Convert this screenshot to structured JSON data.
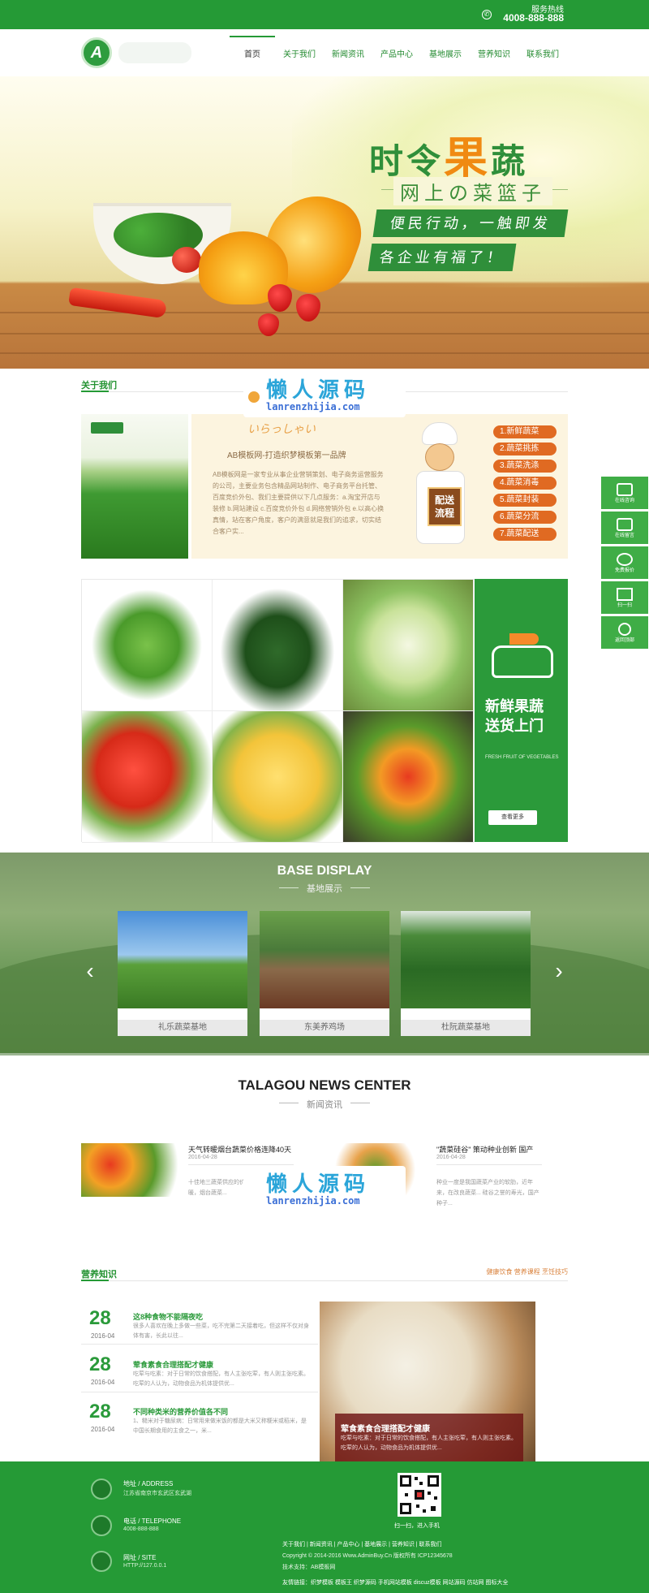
{
  "header": {
    "hotline_label": "服务热线",
    "hotline_number": "4008-888-888",
    "logo_letter": "A",
    "nav": [
      "首页",
      "关于我们",
      "新闻资讯",
      "产品中心",
      "基地展示",
      "营养知识",
      "联系我们"
    ],
    "active_nav": 0
  },
  "banner": {
    "title_a": "时令",
    "title_b": "果",
    "title_c": "蔬",
    "subtitle": "网上の菜篮子",
    "tag1": "便民行动，一触即发",
    "tag2": "各企业有福了！"
  },
  "about": {
    "section_title": "关于我们",
    "script_text": "いらっしゃい",
    "heading": "AB模板网-打造织梦模板第一品牌",
    "text": "AB模板网是一家专业从事企业营销策划、电子商务运营服务的公司，主要业务包含精品网站制作、电子商务平台托管、百度竞价外包、我们主要提供以下几点服务：a.淘宝开店与装修 b.网站建设 c.百度竞价外包 d.网络营销外包 e.以高心换真情，站在客户角度，客户的满意就是我们的追求，切实结合客户实...",
    "chef_board": "配送\n流程",
    "steps": [
      "1.新鲜蔬菜",
      "2.蔬菜挑拣",
      "3.蔬菜洗涤",
      "4.蔬菜消毒",
      "5.蔬菜封装",
      "6.蔬菜分流",
      "7.蔬菜配送"
    ]
  },
  "products": {
    "promo_title": "新鲜果蔬\n送货上门",
    "promo_sub": "FRESH FRUIT OF VEGETABLES",
    "promo_button": "查看更多"
  },
  "base": {
    "title": "BASE DISPLAY",
    "subtitle": "基地展示",
    "items": [
      "礼乐蔬菜基地",
      "东美养鸡场",
      "杜阮蔬菜基地"
    ],
    "prev_arrow": "‹",
    "next_arrow": "›"
  },
  "news": {
    "title": "TALAGOU NEWS CENTER",
    "subtitle": "新闻资讯",
    "items": [
      {
        "title": "天气转暖烟台蔬菜价格连降40天",
        "date": "2016-04-28",
        "text": "十佳地三蔬菜供应的价格... 近期天气转暖，烟台蔬菜..."
      },
      {
        "title": "\"蔬菜硅谷\" 策动种业创新 国产",
        "date": "2016-04-28",
        "text": "种业一度是我国蔬菜产业的软肋，近年来，在改良蔬菜... 硅谷之誉的寿光，国产种子..."
      }
    ]
  },
  "watermark": {
    "text": "懒人源码",
    "url": "lanrenzhijia.com"
  },
  "nutrition": {
    "section_title": "营养知识",
    "links": "健康饮食  营养课程  烹饪技巧",
    "items": [
      {
        "day": "28",
        "ym": "2016-04",
        "title": "这8种食物不能隔夜吃",
        "text": "很多人喜欢在晚上多做一些菜，吃不完第二天接着吃，但这样不仅对身体有害，长此以往..."
      },
      {
        "day": "28",
        "ym": "2016-04",
        "title": "荤食素食合理搭配才健康",
        "text": "吃荤与吃素：对于日常的饮食搭配，有人主张吃荤，有人则主张吃素。吃荤的人认为，动物食品为机体提供优..."
      },
      {
        "day": "28",
        "ym": "2016-04",
        "title": "不同种类米的营养价值各不同",
        "text": "1、糙米对于糖尿病：日常用来做米饭的都是大米又称粳米或稻米，是中国长期食用的主食之一，米..."
      }
    ],
    "caption_title": "荤食素食合理搭配才健康",
    "caption_text": "吃荤与吃素：对于日常的饮食搭配，有人主张吃荤，有人则主张吃素。吃荤的人认为，动物食品为机体提供优..."
  },
  "side": [
    "在线咨询",
    "在线留言",
    "免费报价",
    "扫一扫",
    "返回顶部"
  ],
  "footer": {
    "address_label": "地址 / ADDRESS",
    "address_value": "江苏省南京市玄武区玄武湖",
    "phone_label": "电话 / TELEPHONE",
    "phone_value": "4008-888-888",
    "site_label": "网址 / SITE",
    "site_value": "HTTP://127.0.0.1",
    "qr_caption": "扫一扫，进入手机",
    "links": "关于我们  |  新闻资讯  |  产品中心  |  基地展示  |  营养知识  |  联系我们",
    "copyright": "Copyright © 2014-2016 Www.AdminBuy.Cn 版权所有  ICP12345678",
    "tech": "技术支持：AB模板网",
    "friends": "友情链接：织梦模板  模板王  织梦源码  手机网站模板  discuz模板  网站源码  仿站网  图标大全"
  }
}
